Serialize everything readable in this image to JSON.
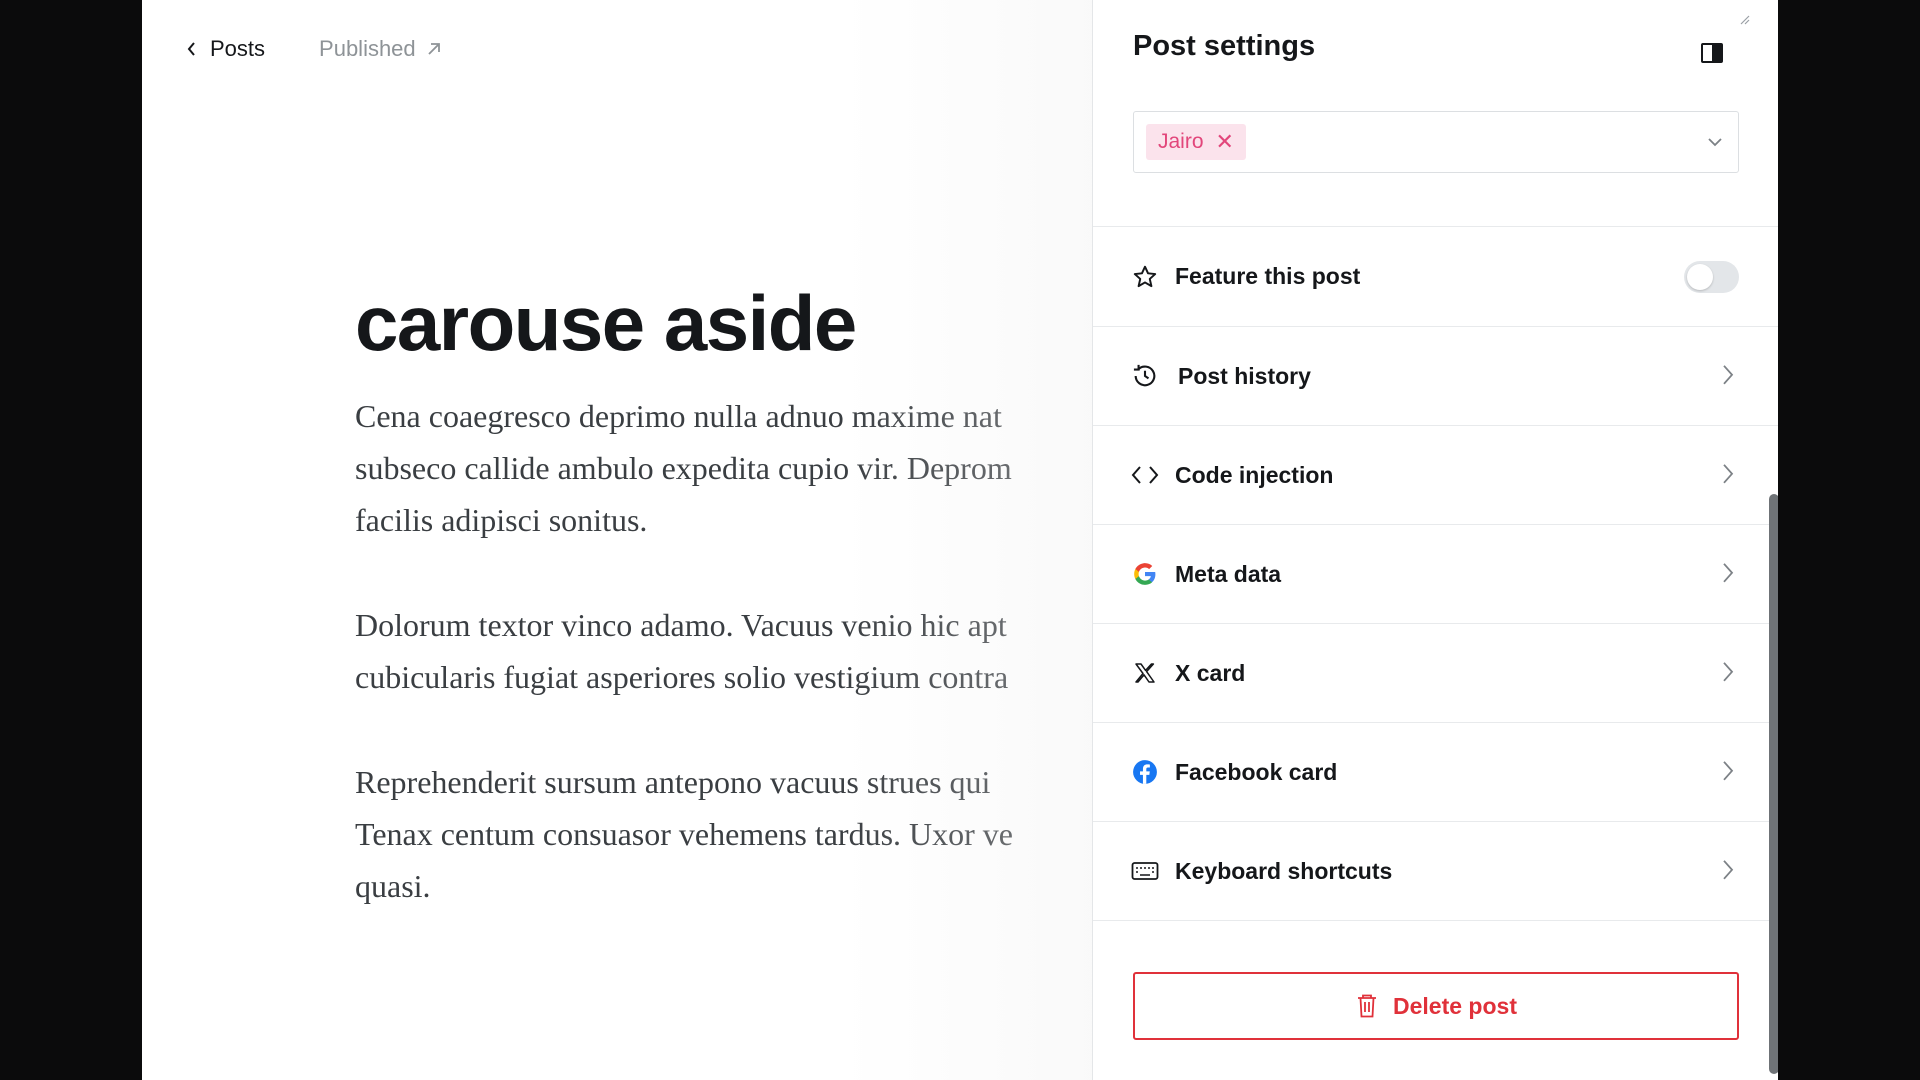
{
  "nav": {
    "back_label": "Posts",
    "status_label": "Published"
  },
  "post": {
    "title": "carouse aside",
    "paragraphs": [
      [
        "Cena coaegresco deprimo nulla adnuo maxime nat",
        "subseco callide ambulo expedita cupio vir. Deprom",
        "facilis adipisci sonitus."
      ],
      [
        "Dolorum textor vinco adamo. Vacuus venio hic apt",
        "cubicularis fugiat asperiores solio vestigium contra"
      ],
      [
        "Reprehenderit sursum antepono vacuus strues qui",
        "Tenax centum consuasor vehemens tardus. Uxor ve",
        "quasi."
      ]
    ]
  },
  "settings": {
    "title": "Post settings",
    "authors": [
      {
        "name": "Jairo"
      }
    ],
    "feature": {
      "label": "Feature this post",
      "enabled": false
    },
    "items": [
      {
        "label": "Post history",
        "icon": "history-icon"
      },
      {
        "label": "Code injection",
        "icon": "code-icon"
      },
      {
        "label": "Meta data",
        "icon": "google-icon"
      },
      {
        "label": "X card",
        "icon": "x-icon"
      },
      {
        "label": "Facebook card",
        "icon": "facebook-icon"
      },
      {
        "label": "Keyboard shortcuts",
        "icon": "keyboard-icon"
      }
    ],
    "delete_label": "Delete post"
  },
  "colors": {
    "accent_pink": "#e2467b",
    "tag_bg": "#fbe3ec",
    "danger": "#e0313a",
    "facebook": "#1877f2"
  }
}
